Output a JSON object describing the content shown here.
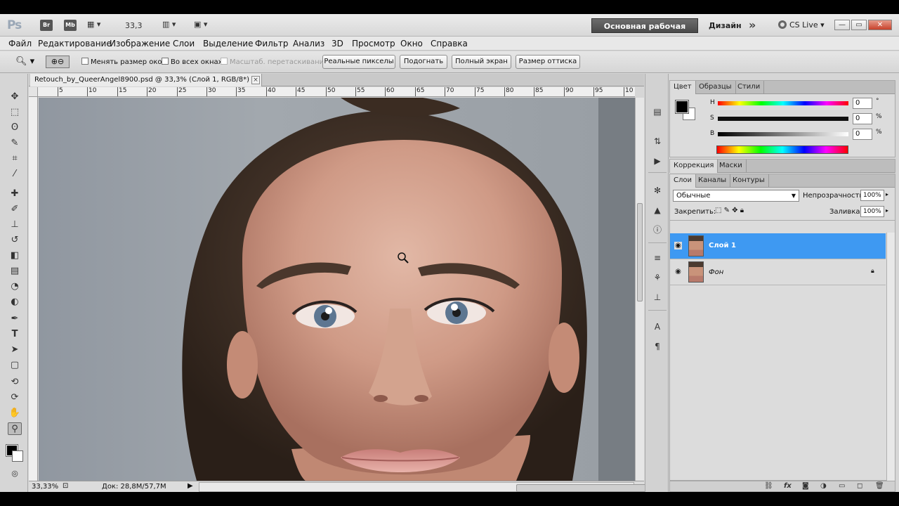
{
  "appbar": {
    "logo": "Ps",
    "br_label": "Br",
    "mb_label": "Mb",
    "zoom": "33,3",
    "workspace_label": "Основная рабочая среда",
    "design_label": "Дизайн",
    "more_label": "»",
    "cslive_label": "CS Live",
    "win_min": "—",
    "win_restore": "▭",
    "win_close": "✕"
  },
  "menu": [
    "Файл",
    "Редактирование",
    "Изображение",
    "Слои",
    "Выделение",
    "Фильтр",
    "Анализ",
    "3D",
    "Просмотр",
    "Окно",
    "Справка"
  ],
  "options": {
    "resize_windows": "Менять размер окон",
    "all_windows": "Во всех окнах",
    "scrubby_zoom": "Масштаб. перетаскиванием",
    "actual_pixels": "Реальные пикселы",
    "fit_screen": "Подогнать",
    "fill_screen": "Полный экран",
    "print_size": "Размер оттиска"
  },
  "document": {
    "tab_title": "Retouch_by_QueerAngel8900.psd @ 33,3% (Слой 1, RGB/8*) *",
    "tab_close": "×",
    "ruler_labels": [
      "5",
      "10",
      "15",
      "20",
      "25",
      "30",
      "35",
      "40",
      "45",
      "50",
      "55",
      "60",
      "65",
      "70",
      "75",
      "80",
      "85",
      "90",
      "95",
      "10"
    ],
    "status_zoom": "33,33%",
    "status_doc": "Док: 28,8M/57,7M"
  },
  "color_panel": {
    "tabs": [
      "Цвет",
      "Образцы",
      "Стили"
    ],
    "sliders": [
      {
        "label": "H",
        "value": "0",
        "unit": "°"
      },
      {
        "label": "S",
        "value": "0",
        "unit": "%"
      },
      {
        "label": "B",
        "value": "0",
        "unit": "%"
      }
    ]
  },
  "adjust_panel": {
    "tabs": [
      "Коррекция",
      "Маски"
    ]
  },
  "layers_panel": {
    "tabs": [
      "Слои",
      "Каналы",
      "Контуры"
    ],
    "blend_mode": "Обычные",
    "opacity_label": "Непрозрачность:",
    "opacity_value": "100%",
    "lock_label": "Закрепить:",
    "fill_label": "Заливка:",
    "fill_value": "100%",
    "layers": [
      {
        "name": "Слой 1",
        "selected": true
      },
      {
        "name": "Фон",
        "selected": false,
        "locked": true
      }
    ]
  },
  "colors": {
    "accent": "#3e99f2",
    "workspace_button": "#5a5a5a"
  },
  "icons": {
    "tools": [
      "move-tool-icon",
      "marquee-tool-icon",
      "lasso-tool-icon",
      "quick-select-tool-icon",
      "crop-tool-icon",
      "eyedropper-tool-icon",
      "healing-brush-icon",
      "brush-tool-icon",
      "clone-stamp-icon",
      "history-brush-icon",
      "eraser-tool-icon",
      "gradient-tool-icon",
      "blur-tool-icon",
      "dodge-tool-icon",
      "pen-tool-icon",
      "type-tool-icon",
      "path-select-icon",
      "shape-tool-icon",
      "3d-rotate-icon",
      "3d-orbit-icon",
      "hand-tool-icon",
      "zoom-tool-icon"
    ]
  }
}
